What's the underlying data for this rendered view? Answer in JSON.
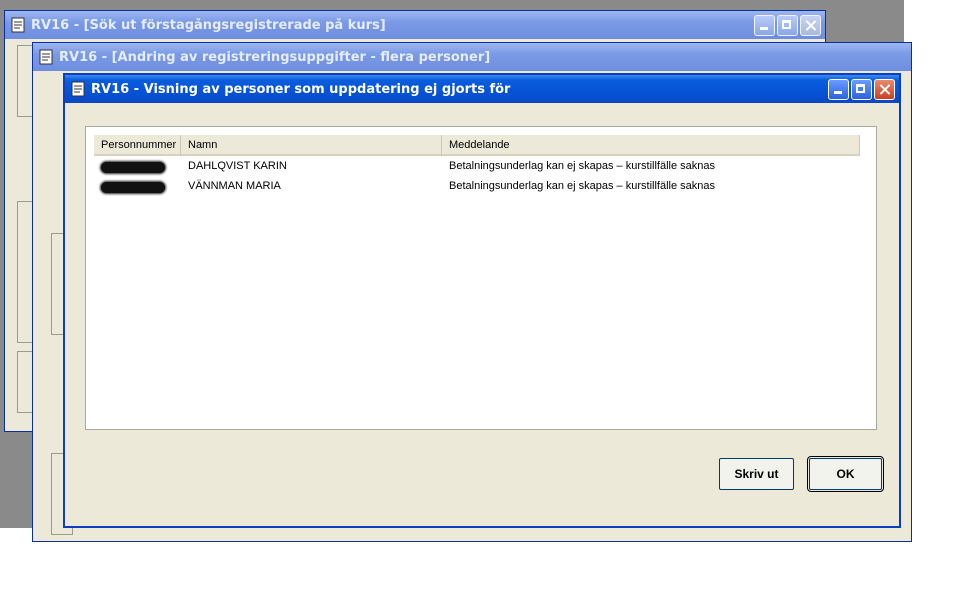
{
  "windows": {
    "back": {
      "title": "RV16 - [Sök ut förstagångsregistrerade på kurs]"
    },
    "middle": {
      "title": "RV16 - [Ändring av registreringsuppgifter - flera personer]"
    },
    "dialog": {
      "title": "RV16 - Visning av personer som uppdatering ej gjorts för"
    }
  },
  "table": {
    "columns": [
      "Personnummer",
      "Namn",
      "Meddelande"
    ],
    "rows": [
      {
        "personnummer": "[redacted]",
        "namn": "DAHLQVIST KARIN",
        "meddelande": "Betalningsunderlag kan ej skapas – kurstillfälle saknas"
      },
      {
        "personnummer": "[redacted]",
        "namn": "VÄNNMAN MARIA",
        "meddelande": "Betalningsunderlag kan ej skapas – kurstillfälle saknas"
      }
    ]
  },
  "buttons": {
    "print": "Skriv ut",
    "ok": "OK"
  },
  "colors": {
    "title_active": "#0553d6",
    "title_inactive": "#7a9ae6",
    "dialog_bg": "#ece9d8"
  }
}
